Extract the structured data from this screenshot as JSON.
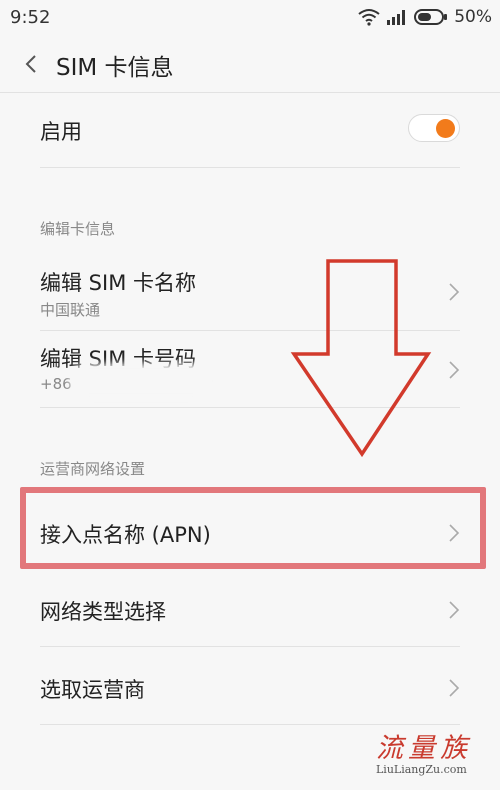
{
  "status_bar": {
    "time": "9:52",
    "battery": "50%"
  },
  "header": {
    "title": "SIM 卡信息"
  },
  "enable": {
    "label": "启用",
    "toggle_on": true,
    "accent_color": "#f27b1b"
  },
  "section_card": {
    "title": "编辑卡信息"
  },
  "edit_name": {
    "label": "编辑 SIM 卡名称",
    "value": "中国联通"
  },
  "edit_number": {
    "label": "编辑 SIM 卡号码",
    "value": "+86"
  },
  "section_network": {
    "title": "运营商网络设置"
  },
  "apn": {
    "label": "接入点名称 (APN)"
  },
  "network_type": {
    "label": "网络类型选择"
  },
  "select_operator": {
    "label": "选取运营商"
  },
  "watermark": {
    "brand": "流量族",
    "url": "LiuLiangZu.com"
  },
  "icons": [
    "back-arrow-icon",
    "wifi-icon",
    "signal-icon",
    "battery-icon",
    "chevron-right-icon",
    "down-arrow-annotation"
  ],
  "highlight_color": "#e2777b"
}
